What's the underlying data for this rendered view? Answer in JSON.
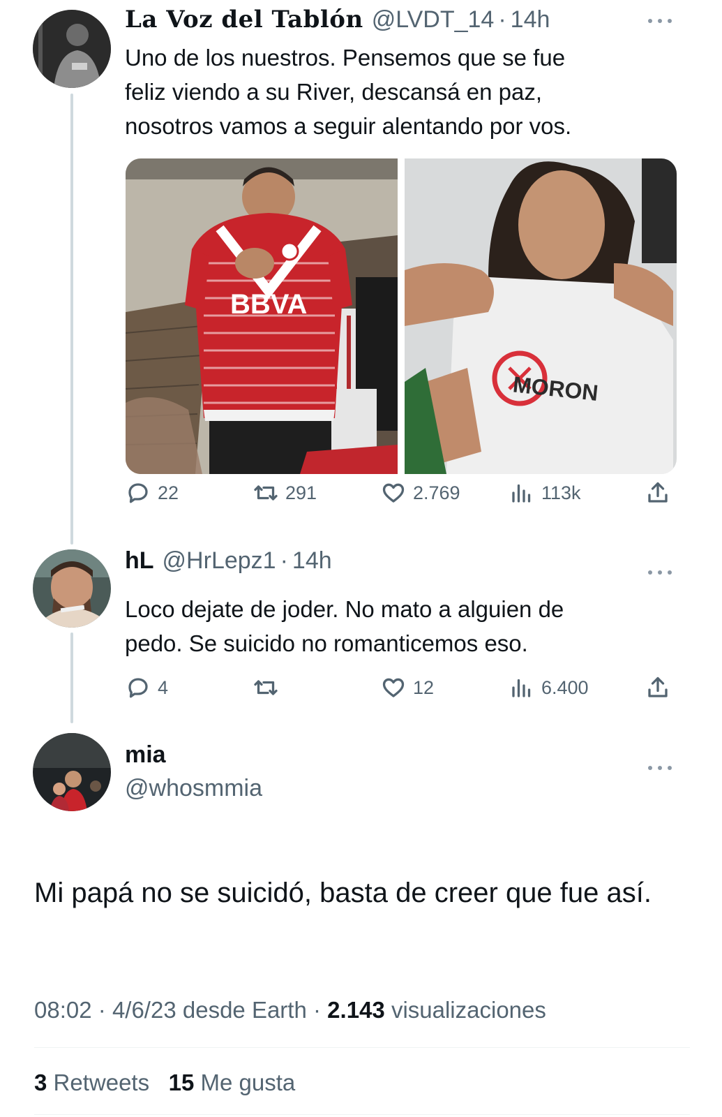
{
  "tweets": [
    {
      "display_name": "La Voz del Tablón",
      "handle": "@LVDT_14",
      "separator": "·",
      "time": "14h",
      "text": "Uno de los nuestros. Pensemos que se fue\nfeliz viendo a su River, descansá en paz,\nnosotros vamos a seguir alentando por vos.",
      "replies": "22",
      "retweets": "291",
      "likes": "2.769",
      "views": "113k"
    },
    {
      "display_name": "hL",
      "handle": "@HrLepz1",
      "separator": "·",
      "time": "14h",
      "text": "Loco dejate de joder. No mato a alguien de\npedo. Se suicido no romanticemos eso.",
      "replies": "4",
      "retweets": "",
      "likes": "12",
      "views": "6.400"
    }
  ],
  "main_tweet": {
    "display_name": "mia",
    "handle": "@whosmmia",
    "text": "Mi papá no se suicidó, basta de creer que fue así.",
    "time": "08:02",
    "date": "4/6/23",
    "source": "desde Earth",
    "separator": "·",
    "views_count": "2.143",
    "views_label": "visualizaciones",
    "retweets_count": "3",
    "retweets_label": "Retweets",
    "likes_count": "15",
    "likes_label": "Me gusta"
  },
  "media_shirt_text": [
    "BBVA",
    "MORON"
  ],
  "colors": {
    "text_primary": "#0f1419",
    "text_secondary": "#536471",
    "thread_line": "#cfd9de",
    "divider": "#eff3f4",
    "river_red": "#c8242b"
  },
  "icons": [
    "more-icon",
    "reply-icon",
    "retweet-icon",
    "like-icon",
    "views-icon",
    "share-icon"
  ]
}
